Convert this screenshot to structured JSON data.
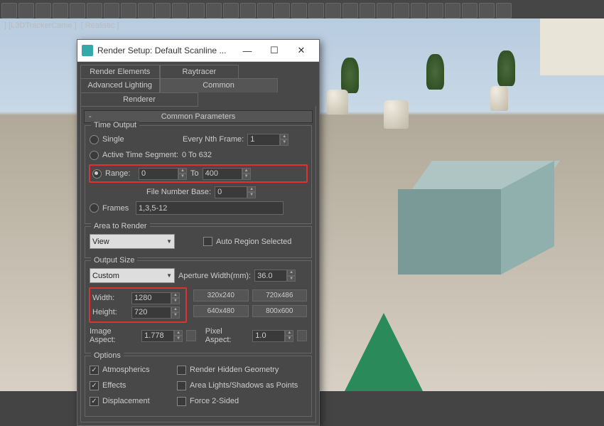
{
  "viewport": {
    "label1": "] [L3DTrackerCame ]",
    "label2": "[ Realistic ]"
  },
  "dialog": {
    "title": "Render Setup: Default Scanline ...",
    "tabs_row1": [
      "Render Elements",
      "Raytracer",
      "Advanced Lighting"
    ],
    "tabs_row2": [
      "Common",
      "Renderer"
    ],
    "active_tab": "Common",
    "rollout": "Common Parameters",
    "time_output": {
      "title": "Time Output",
      "single": "Single",
      "every_nth": "Every Nth Frame:",
      "every_nth_val": "1",
      "active_seg": "Active Time Segment:",
      "active_seg_val": "0 To 632",
      "range": "Range:",
      "range_from": "0",
      "range_to_lbl": "To",
      "range_to": "400",
      "file_base": "File Number Base:",
      "file_base_val": "0",
      "frames": "Frames",
      "frames_val": "1,3,5-12"
    },
    "area": {
      "title": "Area to Render",
      "view": "View",
      "auto": "Auto Region Selected"
    },
    "output": {
      "title": "Output Size",
      "custom": "Custom",
      "aperture": "Aperture Width(mm):",
      "aperture_val": "36.0",
      "width": "Width:",
      "width_val": "1280",
      "height": "Height:",
      "height_val": "720",
      "presets": [
        "320x240",
        "720x486",
        "640x480",
        "800x600"
      ],
      "img_aspect": "Image Aspect:",
      "img_aspect_val": "1.778",
      "pix_aspect": "Pixel Aspect:",
      "pix_aspect_val": "1.0"
    },
    "options": {
      "title": "Options",
      "atmospherics": "Atmospherics",
      "hidden": "Render Hidden Geometry",
      "effects": "Effects",
      "area_lights": "Area Lights/Shadows as Points",
      "displacement": "Displacement",
      "force2": "Force 2-Sided"
    }
  }
}
